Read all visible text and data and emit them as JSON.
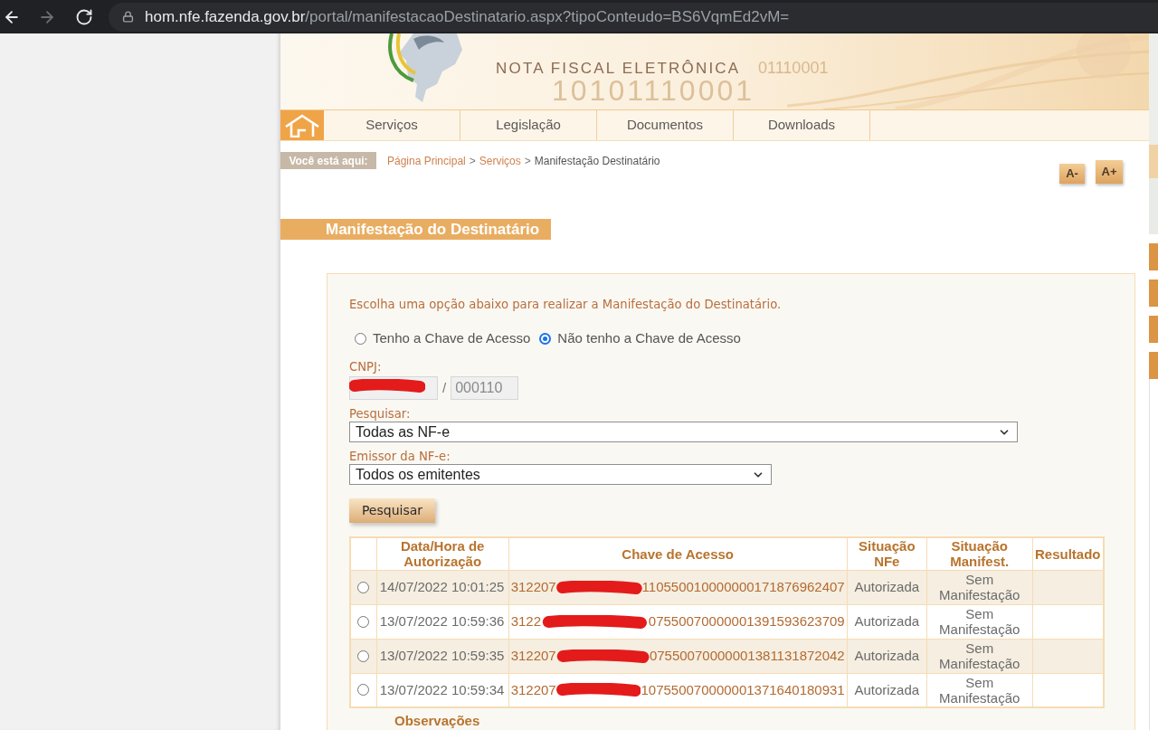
{
  "browser": {
    "buttons": [
      {
        "kind": "back",
        "disabled": false
      },
      {
        "kind": "forward",
        "disabled": true
      },
      {
        "kind": "reload",
        "disabled": false
      }
    ],
    "url_host": "hom.nfe.fazenda.gov.br",
    "url_path": "/portal/manifestacaoDestinatario.aspx?tipoConteudo=BS6VqmEd2vM="
  },
  "banner": {
    "title": "NOTA FISCAL ELETRÔNICA",
    "binary_texts": [
      "01110001",
      "10101110001"
    ]
  },
  "nav": {
    "items": [
      "Serviços",
      "Legislação",
      "Documentos",
      "Downloads"
    ]
  },
  "breadcrumb": {
    "label": "Você está aqui:",
    "items": [
      {
        "kind": "link",
        "text": "Página Principal"
      },
      {
        "kind": "separator",
        "text": ">"
      },
      {
        "kind": "link",
        "text": "Serviços"
      },
      {
        "kind": "separator",
        "text": ">"
      },
      {
        "kind": "current",
        "text": "Manifestação Destinatário"
      }
    ]
  },
  "font_buttons": [
    "A-",
    "A+"
  ],
  "page_title": "Manifestação do Destinatário",
  "form": {
    "intro": "Escolha uma opção abaixo para realizar a Manifestação do Destinatário.",
    "options": [
      {
        "label": "Tenho a Chave de Acesso",
        "selected": false
      },
      {
        "label": "Não tenho a Chave de Acesso",
        "selected": true
      }
    ],
    "cnpj": {
      "label": "CNPJ:",
      "base": {
        "redacted": true,
        "disabled": true
      },
      "separator": "/",
      "branch": {
        "value": "000110",
        "disabled": true
      }
    },
    "search": {
      "label": "Pesquisar:",
      "value": "Todas as NF-e"
    },
    "issuer": {
      "label": "Emissor da NF-e:",
      "value": "Todos os emitentes"
    },
    "submit": "Pesquisar"
  },
  "results": {
    "columns": [
      "Data/Hora de Autorização",
      "Chave de Acesso",
      "Situação NFe",
      "Situação Manifest.",
      "Resultado"
    ],
    "rows": [
      {
        "selected": false,
        "authorized_at": "14/07/2022 10:01:25",
        "access_key": {
          "start": "312207",
          "end": "110550010000000171876962407",
          "redacted": true
        },
        "nfe_status": "Autorizada",
        "manifest_status": "Sem Manifestação"
      },
      {
        "selected": false,
        "authorized_at": "13/07/2022 10:59:36",
        "access_key": {
          "start": "3122",
          "end": "07550070000001391593623709",
          "redacted": true
        },
        "nfe_status": "Autorizada",
        "manifest_status": "Sem Manifestação"
      },
      {
        "selected": false,
        "authorized_at": "13/07/2022 10:59:35",
        "access_key": {
          "start": "312207",
          "end": "07550070000001381131872042",
          "redacted": true
        },
        "nfe_status": "Autorizada",
        "manifest_status": "Sem Manifestação"
      },
      {
        "selected": false,
        "authorized_at": "13/07/2022 10:59:34",
        "access_key": {
          "start": "312207",
          "end": "107550070000001371640180931",
          "redacted": true
        },
        "nfe_status": "Autorizada",
        "manifest_status": "Sem Manifestação"
      }
    ]
  },
  "notes_heading": "Observações"
}
